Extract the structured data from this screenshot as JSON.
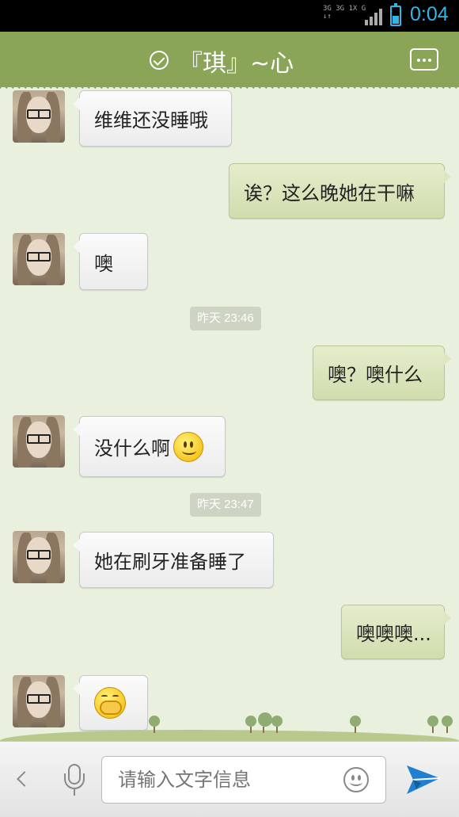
{
  "status_bar": {
    "network_line1": "3G 3G 1X  G",
    "network_line2": "↓↑",
    "time": "0:04",
    "accent_color": "#33b5e5"
  },
  "header": {
    "title": "『琪』~心",
    "status_icon": "verified-check-icon",
    "menu_icon": "more-dots-icon",
    "background_color": "#8aa557"
  },
  "messages": [
    {
      "type": "received",
      "text": "维维还没睡哦"
    },
    {
      "type": "sent",
      "text": "诶？这么晚她在干嘛"
    },
    {
      "type": "received",
      "text": "噢"
    },
    {
      "type": "timestamp",
      "text": "昨天 23:46"
    },
    {
      "type": "sent",
      "text": "噢？噢什么"
    },
    {
      "type": "received",
      "text": "没什么啊",
      "emoji": "smile-emoji"
    },
    {
      "type": "timestamp",
      "text": "昨天 23:47"
    },
    {
      "type": "received",
      "text": "她在刷牙准备睡了"
    },
    {
      "type": "sent",
      "text": "噢噢噢..."
    },
    {
      "type": "received",
      "text": "",
      "emoji": "shy-emoji"
    }
  ],
  "input_bar": {
    "placeholder": "请输入文字信息",
    "back_icon": "chevron-left-icon",
    "voice_icon": "microphone-icon",
    "emoji_icon": "smiley-icon",
    "send_icon": "paper-plane-icon",
    "send_color": "#1f7fd1"
  }
}
